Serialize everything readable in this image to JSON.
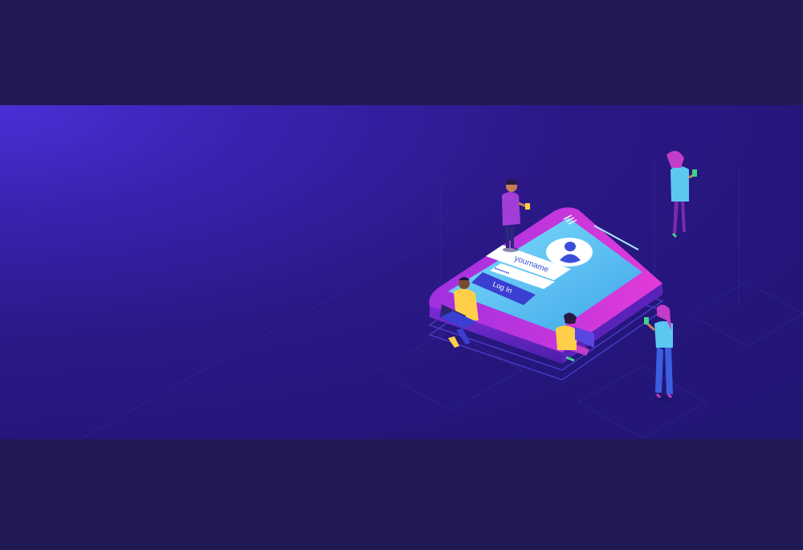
{
  "illustration": {
    "login_form": {
      "username_placeholder": "yourname",
      "password_mask": "••••••••",
      "login_button_label": "Log In"
    }
  },
  "colors": {
    "background": "#211a52",
    "banner_gradient_start": "#4a2fd6",
    "banner_gradient_end": "#221673",
    "phone_body": "#d63be0",
    "phone_screen": "#5bc8f2",
    "button": "#3a3fd1"
  },
  "icons": [
    "user-avatar-icon",
    "hamburger-menu-icon"
  ]
}
